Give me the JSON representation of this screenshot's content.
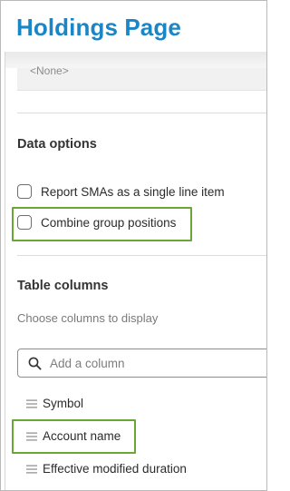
{
  "header": {
    "title": "Holdings Page"
  },
  "top_field": {
    "value": "<None>"
  },
  "data_options": {
    "title": "Data options",
    "items": [
      {
        "label": "Report SMAs as a single line item",
        "checked": false
      },
      {
        "label": "Combine group positions",
        "checked": false
      }
    ]
  },
  "table_columns": {
    "title": "Table columns",
    "help": "Choose columns to display",
    "search": {
      "placeholder": "Add a column",
      "value": ""
    },
    "columns": [
      {
        "label": "Symbol"
      },
      {
        "label": "Account name"
      },
      {
        "label": "Effective modified duration"
      }
    ]
  },
  "colors": {
    "title": "#1b86c6",
    "highlight": "#6aa636"
  }
}
